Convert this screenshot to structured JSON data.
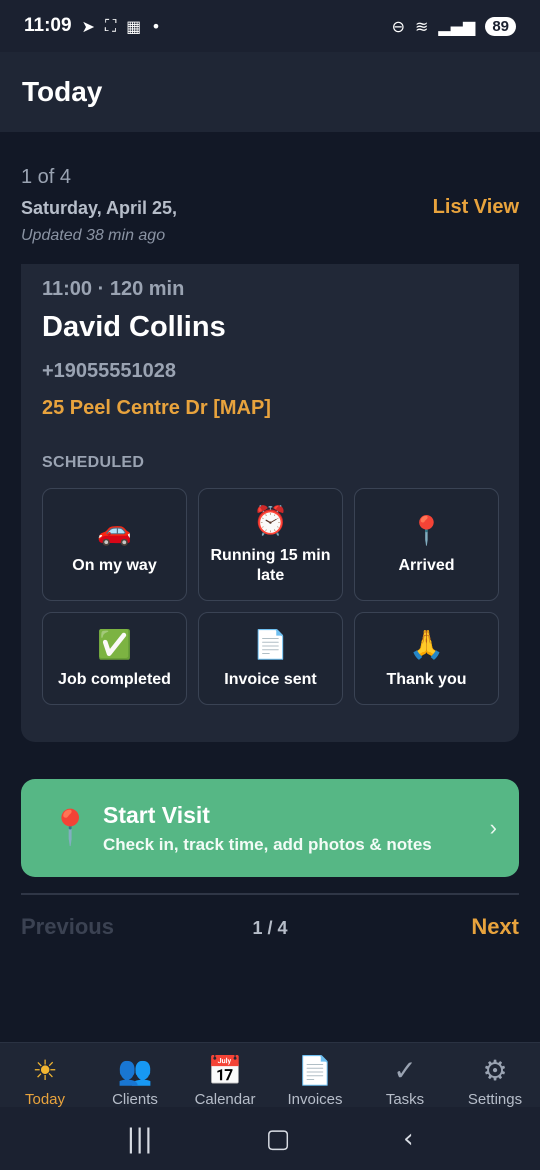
{
  "status_bar": {
    "time": "11:09",
    "left_icons": [
      "telegram-icon",
      "screenshot-icon",
      "calendar-icon",
      "dot-icon"
    ],
    "battery": "89"
  },
  "header": {
    "title": "Today"
  },
  "summary": {
    "count": "1 of 4",
    "date": "Saturday, April 25,",
    "updated": "Updated 38 min ago",
    "list_view": "List View"
  },
  "visit": {
    "time": "11:00 · 120 min",
    "client_name": "David Collins",
    "phone": "+19055551028",
    "address": "25 Peel Centre Dr [MAP]",
    "status": "SCHEDULED"
  },
  "quick_actions": [
    {
      "emoji": "🚗",
      "icon": "car-icon",
      "label": "On my way"
    },
    {
      "emoji": "⏰",
      "icon": "alarm-clock-icon",
      "label": "Running 15 min late"
    },
    {
      "emoji": "📍",
      "icon": "pin-icon",
      "label": "Arrived"
    },
    {
      "emoji": "✅",
      "icon": "check-icon",
      "label": "Job completed"
    },
    {
      "emoji": "📄",
      "icon": "document-icon",
      "label": "Invoice sent"
    },
    {
      "emoji": "🙏",
      "icon": "praying-hands-icon",
      "label": "Thank you"
    }
  ],
  "start_visit": {
    "title": "Start Visit",
    "subtitle": "Check in, track time, add photos & notes",
    "icon": "pin-icon"
  },
  "pager": {
    "previous": "Previous",
    "indicator": "1 / 4",
    "next": "Next"
  },
  "bottom_nav": [
    {
      "label": "Today",
      "icon": "sun-icon",
      "glyph": "☀",
      "active": true
    },
    {
      "label": "Clients",
      "icon": "people-icon",
      "glyph": "👥",
      "active": false
    },
    {
      "label": "Calendar",
      "icon": "calendar-icon",
      "glyph": "📅",
      "active": false
    },
    {
      "label": "Invoices",
      "icon": "invoice-icon",
      "glyph": "📄",
      "active": false
    },
    {
      "label": "Tasks",
      "icon": "checkmark-icon",
      "glyph": "✓",
      "active": false
    },
    {
      "label": "Settings",
      "icon": "gear-icon",
      "glyph": "⚙",
      "active": false
    }
  ],
  "colors": {
    "accent": "#e8a33d",
    "start_green": "#56b785",
    "background": "#121826"
  }
}
